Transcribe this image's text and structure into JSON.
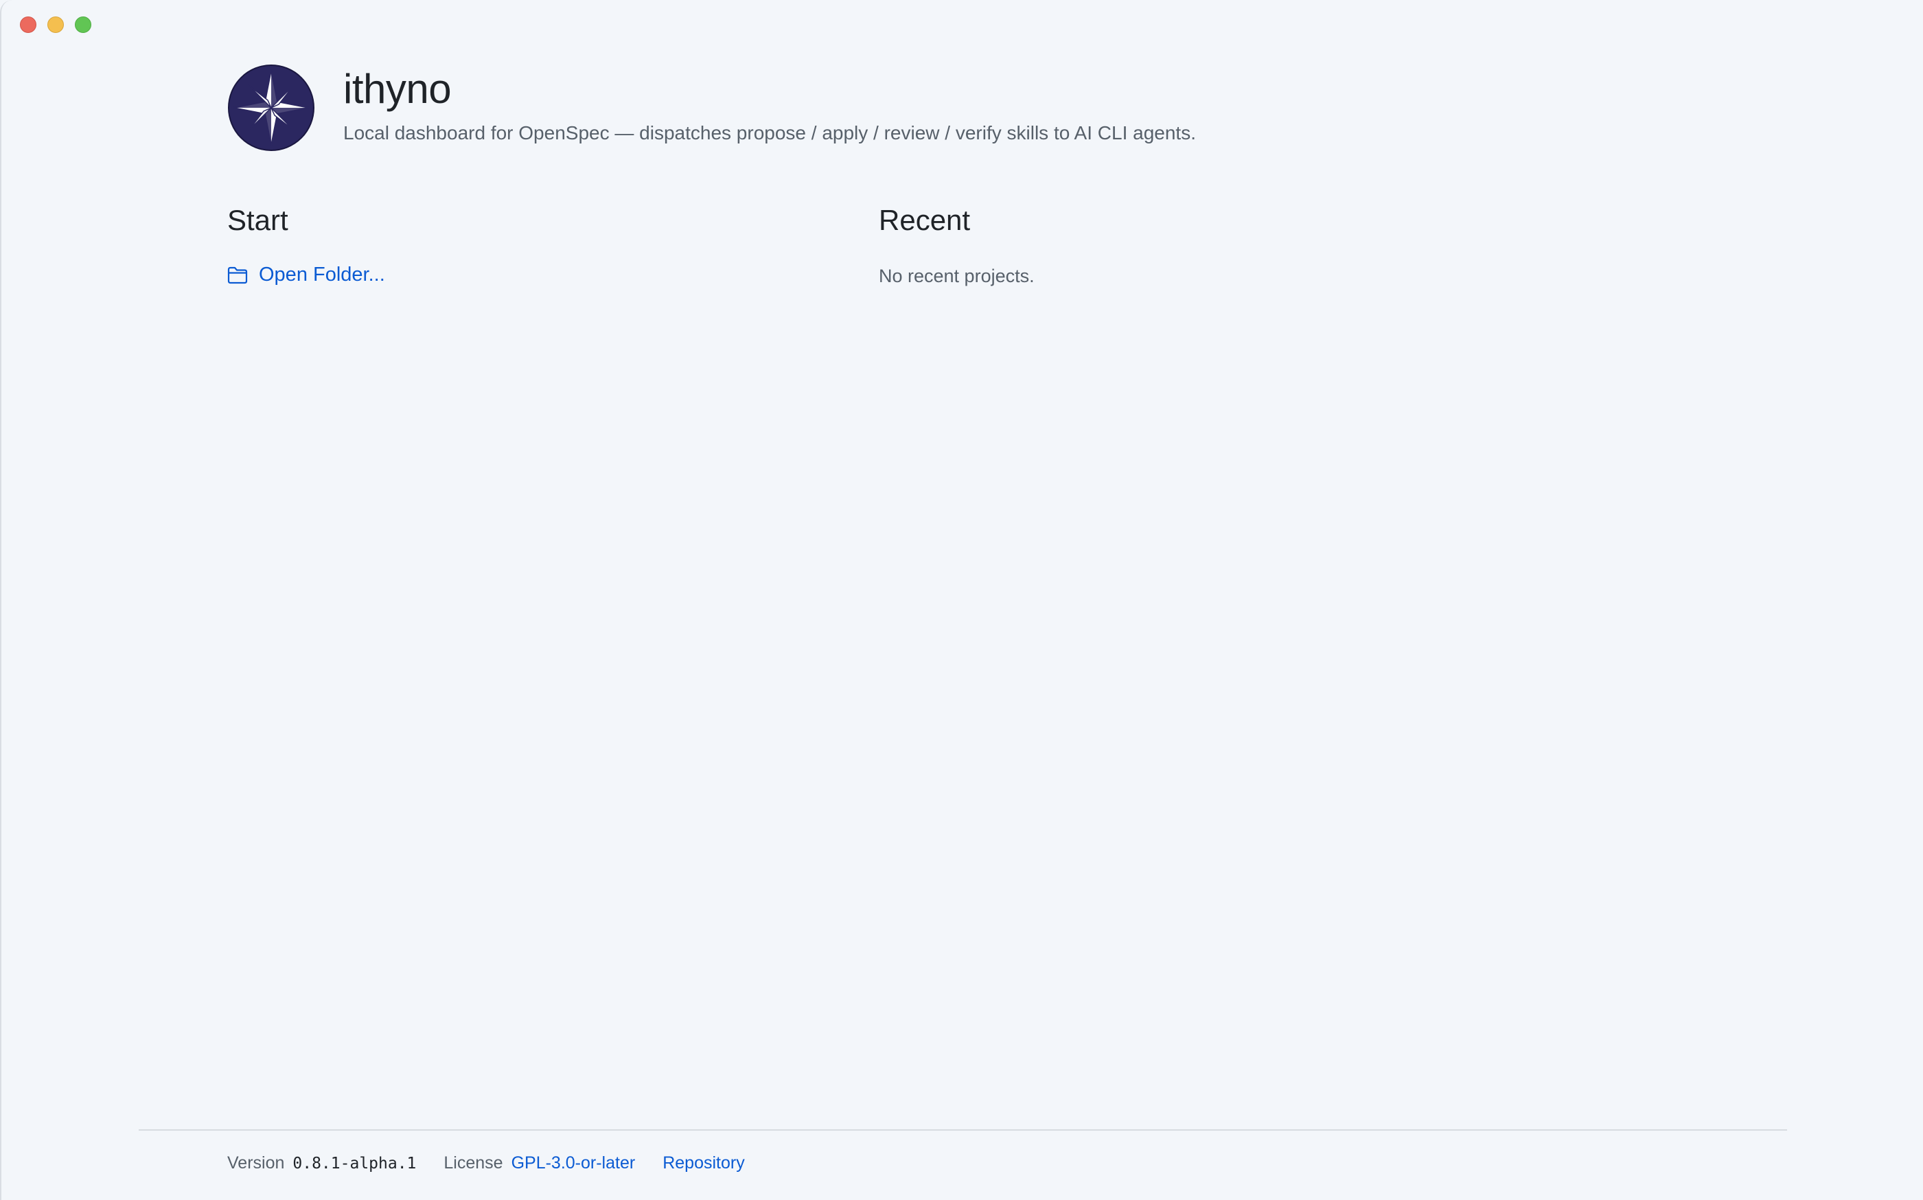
{
  "window": {
    "controls": [
      "close",
      "minimize",
      "maximize"
    ]
  },
  "header": {
    "app_name": "ithyno",
    "subtitle": "Local dashboard for OpenSpec — dispatches propose / apply / review / verify skills to AI CLI agents.",
    "logo_icon": "compass-star-logo-icon"
  },
  "start": {
    "title": "Start",
    "open_folder_label": "Open Folder...",
    "open_folder_icon": "folder-icon"
  },
  "recent": {
    "title": "Recent",
    "empty_text": "No recent projects."
  },
  "footer": {
    "version_label": "Version",
    "version_value": "0.8.1-alpha.1",
    "license_label": "License",
    "license_value": "GPL-3.0-or-later",
    "repository_label": "Repository"
  },
  "colors": {
    "background": "#f3f6fa",
    "link": "#0b5bd3",
    "logo_fill": "#2b2760",
    "text_primary": "#1f2328",
    "text_secondary": "#57606a"
  }
}
